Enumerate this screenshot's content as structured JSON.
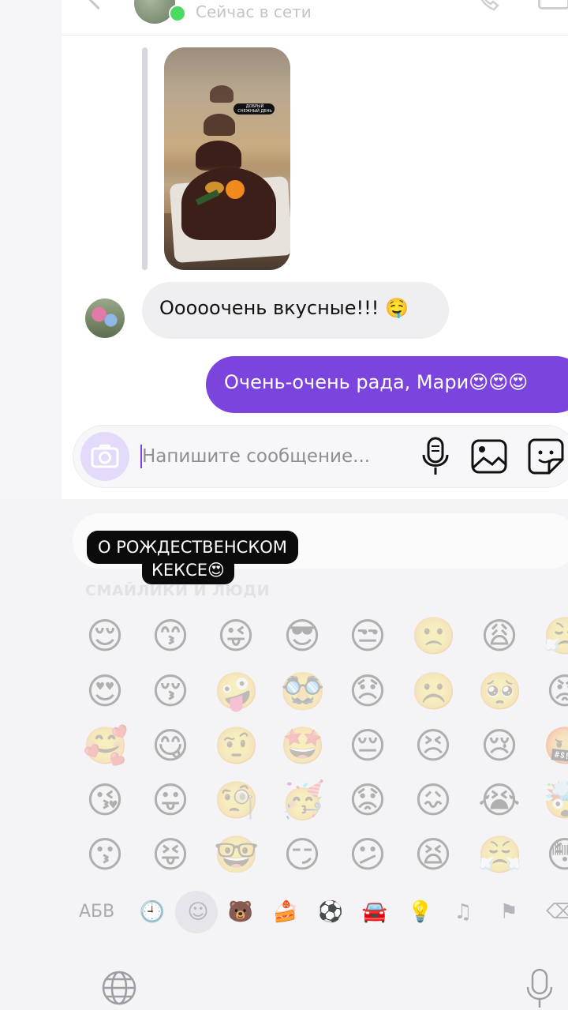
{
  "header": {
    "status": "Сейчас в сети",
    "status_color": "#4cd964"
  },
  "story_reply": {
    "tag_text": "ДОБРЫЙ СНЕЖНЫЙ ДЕНЬ"
  },
  "messages": [
    {
      "direction": "incoming",
      "text": "Ооооочень вкусные!!! 🤤"
    },
    {
      "direction": "outgoing",
      "text": "Очень-очень рада, Мари😍😍😍"
    }
  ],
  "composer": {
    "placeholder": "Напишите сообщение..."
  },
  "overlay_caption": {
    "line1": "О РОЖДЕСТВЕНСКОМ",
    "line2": "КЕКСЕ😍"
  },
  "emoji_keyboard": {
    "section_title": "СМАЙЛИКИ И ЛЮДИ",
    "rows": [
      [
        "😌",
        "😙",
        "😜",
        "😎",
        "😒",
        "🙁",
        "😩",
        "😤"
      ],
      [
        "😍",
        "😚",
        "🤪",
        "🥸",
        "😞",
        "☹️",
        "🥺",
        "😡"
      ],
      [
        "🥰",
        "😋",
        "🤨",
        "🤩",
        "😔",
        "😣",
        "😢",
        "🤬"
      ],
      [
        "😘",
        "😛",
        "🧐",
        "🥳",
        "😟",
        "😖",
        "😭",
        "🤯"
      ],
      [
        "😗",
        "😝",
        "🤓",
        "😏",
        "😕",
        "😫",
        "😤",
        "😳"
      ]
    ],
    "categories": [
      {
        "label": "АБВ",
        "icon": "abc-text"
      },
      {
        "label": "🕘",
        "icon": "recent-icon"
      },
      {
        "label": "☺",
        "icon": "smileys-icon"
      },
      {
        "label": "🐻",
        "icon": "animals-icon"
      },
      {
        "label": "🍰",
        "icon": "food-icon"
      },
      {
        "label": "⚽",
        "icon": "activity-icon"
      },
      {
        "label": "🚘",
        "icon": "travel-icon"
      },
      {
        "label": "💡",
        "icon": "objects-icon"
      },
      {
        "label": "♫",
        "icon": "symbols-icon"
      },
      {
        "label": "⚑",
        "icon": "flags-icon"
      },
      {
        "label": "⌫",
        "icon": "backspace-icon"
      }
    ]
  },
  "colors": {
    "accent": "#7b45dd",
    "incoming_bubble": "#efeff2",
    "camera_button": "#e4dafa"
  }
}
